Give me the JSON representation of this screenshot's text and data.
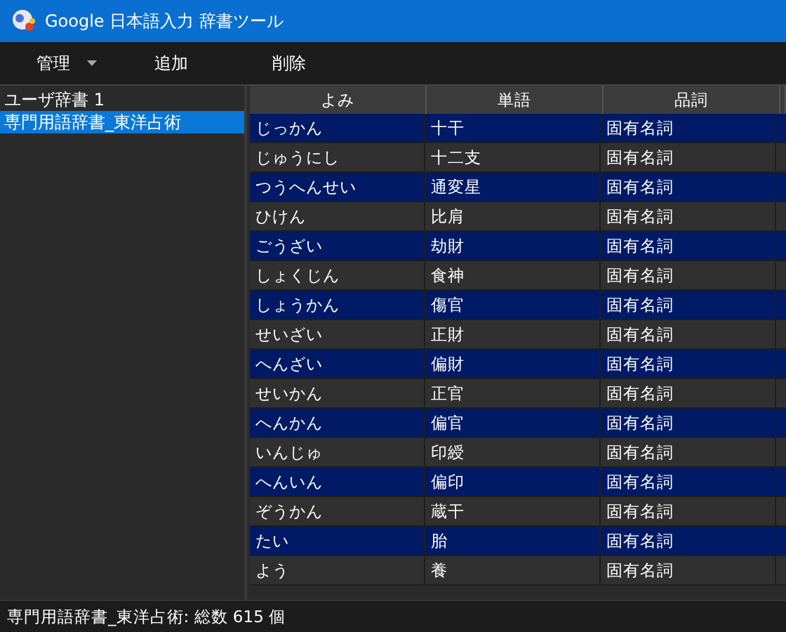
{
  "window": {
    "title": "Google 日本語入力 辞書ツール"
  },
  "toolbar": [
    {
      "label": "管理",
      "dropdown": true
    },
    {
      "label": "追加",
      "dropdown": false
    },
    {
      "label": "削除",
      "dropdown": false
    }
  ],
  "sidebar": {
    "items": [
      {
        "label": "ユーザ辞書 1",
        "selected": false
      },
      {
        "label": "専門用語辞書_東洋占術",
        "selected": true
      }
    ]
  },
  "table": {
    "columns": [
      "よみ",
      "単語",
      "品詞"
    ],
    "rows": [
      [
        "じっかん",
        "十干",
        "固有名詞"
      ],
      [
        "じゅうにし",
        "十二支",
        "固有名詞"
      ],
      [
        "つうへんせい",
        "通変星",
        "固有名詞"
      ],
      [
        "ひけん",
        "比肩",
        "固有名詞"
      ],
      [
        "ごうざい",
        "劫財",
        "固有名詞"
      ],
      [
        "しょくじん",
        "食神",
        "固有名詞"
      ],
      [
        "しょうかん",
        "傷官",
        "固有名詞"
      ],
      [
        "せいざい",
        "正財",
        "固有名詞"
      ],
      [
        "へんざい",
        "偏財",
        "固有名詞"
      ],
      [
        "せいかん",
        "正官",
        "固有名詞"
      ],
      [
        "へんかん",
        "偏官",
        "固有名詞"
      ],
      [
        "いんじゅ",
        "印綬",
        "固有名詞"
      ],
      [
        "へんいん",
        "偏印",
        "固有名詞"
      ],
      [
        "ぞうかん",
        "蔵干",
        "固有名詞"
      ],
      [
        "たい",
        "胎",
        "固有名詞"
      ],
      [
        "よう",
        "養",
        "固有名詞"
      ]
    ]
  },
  "status_bar": "専門用語辞書_東洋占術: 総数 615 個"
}
